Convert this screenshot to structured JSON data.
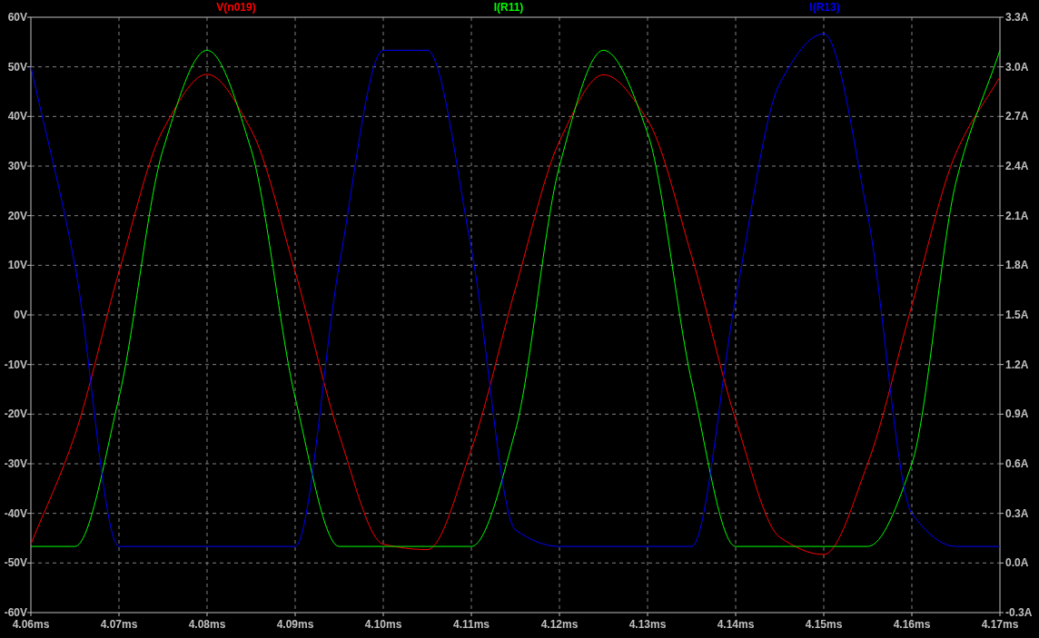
{
  "plot": {
    "chart_data": {
      "type": "line",
      "grid": true,
      "x": [
        4.06,
        4.065,
        4.07,
        4.075,
        4.08,
        4.085,
        4.09,
        4.095,
        4.1,
        4.105,
        4.11,
        4.115,
        4.12,
        4.125,
        4.13,
        4.135,
        4.14,
        4.145,
        4.15,
        4.155,
        4.16,
        4.165,
        4.17
      ],
      "xlim": [
        4.06,
        4.17
      ],
      "xticks": [
        {
          "value": 4.06,
          "label": "4.06ms"
        },
        {
          "value": 4.07,
          "label": "4.07ms"
        },
        {
          "value": 4.08,
          "label": "4.08ms"
        },
        {
          "value": 4.09,
          "label": "4.09ms"
        },
        {
          "value": 4.1,
          "label": "4.10ms"
        },
        {
          "value": 4.11,
          "label": "4.11ms"
        },
        {
          "value": 4.12,
          "label": "4.12ms"
        },
        {
          "value": 4.13,
          "label": "4.13ms"
        },
        {
          "value": 4.14,
          "label": "4.14ms"
        },
        {
          "value": 4.15,
          "label": "4.15ms"
        },
        {
          "value": 4.16,
          "label": "4.16ms"
        },
        {
          "value": 4.17,
          "label": "4.17ms"
        }
      ],
      "ylim": [
        -60,
        60
      ],
      "yticks": [
        {
          "value": 60,
          "label": "60V"
        },
        {
          "value": 50,
          "label": "50V"
        },
        {
          "value": 40,
          "label": "40V"
        },
        {
          "value": 30,
          "label": "30V"
        },
        {
          "value": 20,
          "label": "20V"
        },
        {
          "value": 10,
          "label": "10V"
        },
        {
          "value": 0,
          "label": "0V"
        },
        {
          "value": -10,
          "label": "-10V"
        },
        {
          "value": -20,
          "label": "-20V"
        },
        {
          "value": -30,
          "label": "-30V"
        },
        {
          "value": -40,
          "label": "-40V"
        },
        {
          "value": -50,
          "label": "-50V"
        },
        {
          "value": -60,
          "label": "-60V"
        }
      ],
      "y2lim": [
        -0.3,
        3.3
      ],
      "y2ticks": [
        {
          "value": 3.3,
          "label": "3.3A"
        },
        {
          "value": 3.0,
          "label": "3.0A"
        },
        {
          "value": 2.7,
          "label": "2.7A"
        },
        {
          "value": 2.4,
          "label": "2.4A"
        },
        {
          "value": 2.1,
          "label": "2.1A"
        },
        {
          "value": 1.8,
          "label": "1.8A"
        },
        {
          "value": 1.5,
          "label": "1.5A"
        },
        {
          "value": 1.2,
          "label": "1.2A"
        },
        {
          "value": 0.9,
          "label": "0.9A"
        },
        {
          "value": 0.6,
          "label": "0.6A"
        },
        {
          "value": 0.3,
          "label": "0.3A"
        },
        {
          "value": 0.0,
          "label": "0.0A"
        },
        {
          "value": -0.3,
          "label": "-0.3A"
        }
      ],
      "series": [
        {
          "name": "V(n019)",
          "color": "#ff0000",
          "axis": "y",
          "values": [
            -46.2,
            -24.2,
            8.7,
            37.3,
            48.5,
            37.3,
            8.7,
            -24.2,
            -46.2,
            -47.3,
            -27.1,
            5.3,
            35.0,
            48.4,
            39.3,
            11.9,
            -21.1,
            -44.8,
            -48.3,
            -29.9,
            1.9,
            32.6,
            48.0
          ]
        },
        {
          "name": "I(R11)",
          "color": "#00ff00",
          "axis": "y2",
          "values": [
            0.1,
            0.1,
            1.0,
            2.5,
            3.1,
            2.5,
            1.0,
            0.1,
            0.1,
            0.1,
            0.1,
            0.8,
            2.4,
            3.1,
            2.6,
            1.1,
            0.1,
            0.1,
            0.1,
            0.1,
            0.6,
            2.3,
            3.1
          ]
        },
        {
          "name": "I(R13)",
          "color": "#0000ff",
          "axis": "y2",
          "values": [
            3.0,
            1.8,
            0.1,
            0.1,
            0.1,
            0.1,
            0.1,
            1.8,
            3.1,
            3.1,
            1.9,
            0.2,
            0.1,
            0.1,
            0.1,
            0.1,
            1.6,
            2.9,
            3.2,
            2.1,
            0.3,
            0.1,
            0.1
          ]
        }
      ]
    }
  }
}
